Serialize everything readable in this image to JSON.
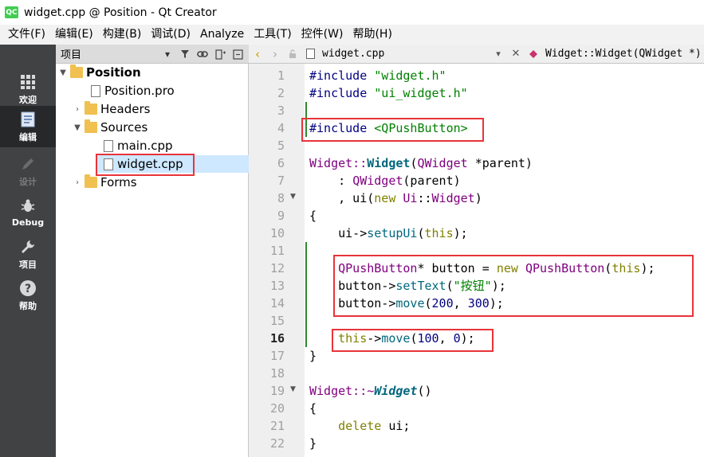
{
  "window": {
    "title": "widget.cpp @ Position - Qt Creator",
    "logo_text": "QC"
  },
  "menu": [
    "文件(F)",
    "编辑(E)",
    "构建(B)",
    "调试(D)",
    "Analyze",
    "工具(T)",
    "控件(W)",
    "帮助(H)"
  ],
  "modes": [
    {
      "label": "欢迎",
      "icon": "grid-icon"
    },
    {
      "label": "编辑",
      "icon": "edit-icon"
    },
    {
      "label": "设计",
      "icon": "pencil-icon"
    },
    {
      "label": "Debug",
      "icon": "bug-icon"
    },
    {
      "label": "项目",
      "icon": "wrench-icon"
    },
    {
      "label": "帮助",
      "icon": "help-icon"
    }
  ],
  "project_panel": {
    "title": "项目",
    "tree": {
      "root": "Position",
      "pro_file": "Position.pro",
      "headers": "Headers",
      "sources": "Sources",
      "main_cpp": "main.cpp",
      "widget_cpp": "widget.cpp",
      "forms": "Forms"
    }
  },
  "editor": {
    "document": "widget.cpp",
    "symbol": "Widget::Widget(QWidget *)",
    "current_line": 16,
    "line_numbers": [
      "1",
      "2",
      "3",
      "4",
      "5",
      "6",
      "7",
      "8",
      "9",
      "10",
      "11",
      "12",
      "13",
      "14",
      "15",
      "16",
      "17",
      "18",
      "19",
      "20",
      "21",
      "22"
    ],
    "code": {
      "l1_a": "#include ",
      "l1_b": "\"widget.h\"",
      "l2_a": "#include ",
      "l2_b": "\"ui_widget.h\"",
      "l4_a": "#include ",
      "l4_b": "<QPushButton>",
      "l6_a": "Widget::",
      "l6_b": "Widget",
      "l6_c": "(",
      "l6_d": "QWidget",
      "l6_e": " *parent)",
      "l7_a": "    : ",
      "l7_b": "QWidget",
      "l7_c": "(parent)",
      "l8_a": "    , ui(",
      "l8_b": "new",
      "l8_c": " ",
      "l8_d": "Ui",
      "l8_e": "::",
      "l8_f": "Widget",
      "l8_g": ")",
      "l9": "{",
      "l10_a": "    ui->",
      "l10_b": "setupUi",
      "l10_c": "(",
      "l10_d": "this",
      "l10_e": ");",
      "l12_a": "    ",
      "l12_b": "QPushButton",
      "l12_c": "* button = ",
      "l12_d": "new",
      "l12_e": " ",
      "l12_f": "QPushButton",
      "l12_g": "(",
      "l12_h": "this",
      "l12_i": ");",
      "l13_a": "    button->",
      "l13_b": "setText",
      "l13_c": "(",
      "l13_d": "\"按钮\"",
      "l13_e": ");",
      "l14_a": "    button->",
      "l14_b": "move",
      "l14_c": "(",
      "l14_d": "200",
      "l14_e": ", ",
      "l14_f": "300",
      "l14_g": ");",
      "l16_a": "    ",
      "l16_b": "this",
      "l16_c": "->",
      "l16_d": "move",
      "l16_e": "(",
      "l16_f": "100",
      "l16_g": ", ",
      "l16_h": "0",
      "l16_i": ");",
      "l17": "}",
      "l19_a": "Widget::~",
      "l19_b": "Widget",
      "l19_c": "()",
      "l20": "{",
      "l21_a": "    ",
      "l21_b": "delete",
      "l21_c": " ui;",
      "l22": "}"
    }
  },
  "colors": {
    "mode_bar": "#404244",
    "mode_active": "#262829",
    "highlight": "#e8343a",
    "selection": "#cde8ff",
    "modified_marker": "#2e8b2e"
  }
}
